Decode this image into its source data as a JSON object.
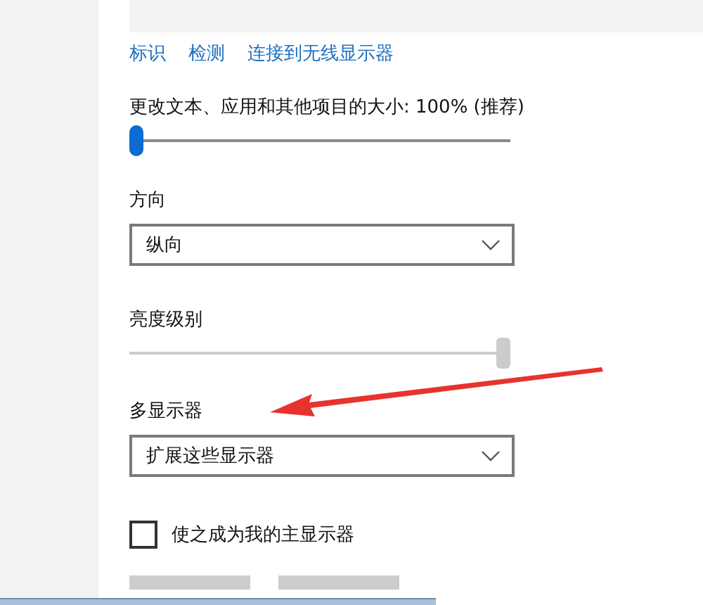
{
  "links": [
    {
      "label": "标识"
    },
    {
      "label": "检测"
    },
    {
      "label": "连接到无线显示器"
    }
  ],
  "scale": {
    "label": "更改文本、应用和其他项目的大小: 100% (推荐)",
    "level": 0,
    "disabled": false
  },
  "orientation": {
    "label": "方向",
    "value": "纵向"
  },
  "brightness": {
    "label": "亮度级别",
    "level": 1,
    "disabled": true
  },
  "multiple_displays": {
    "label": "多显示器",
    "value": "扩展这些显示器"
  },
  "main_display": {
    "label": "使之成为我的主显示器",
    "checked": false
  },
  "annotation": {
    "kind": "arrow"
  },
  "buttons": [
    {
      "kind": "blank"
    },
    {
      "kind": "blank"
    }
  ]
}
